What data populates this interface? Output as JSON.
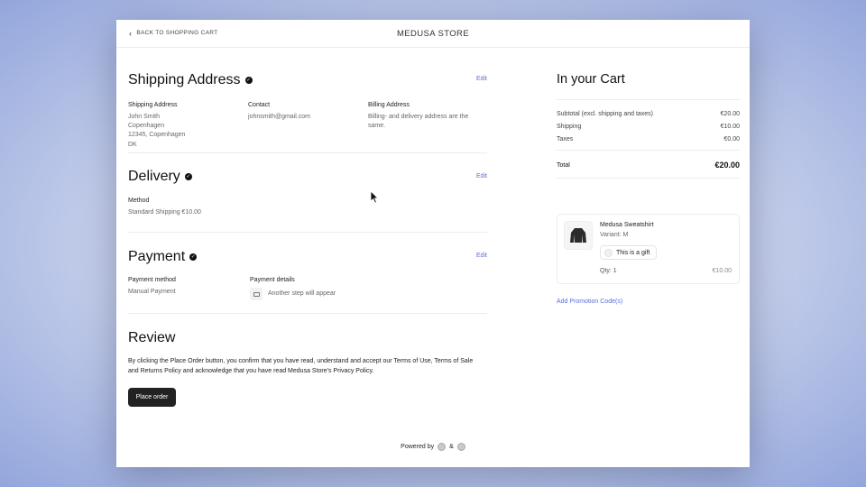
{
  "header": {
    "back_label": "BACK TO SHOPPING CART",
    "store_title": "MEDUSA STORE"
  },
  "shipping": {
    "title": "Shipping Address",
    "edit_label": "Edit",
    "address_label": "Shipping Address",
    "address_lines": [
      "John Smith",
      "Copenhagen",
      "12345, Copenhagen",
      "DK"
    ],
    "contact_label": "Contact",
    "contact_value": "johnsmith@gmail.com",
    "billing_label": "Billing Address",
    "billing_lines": [
      "Billing- and delivery address are the",
      "same."
    ]
  },
  "delivery": {
    "title": "Delivery",
    "edit_label": "Edit",
    "method_label": "Method",
    "method_value": "Standard Shipping €10.00"
  },
  "payment": {
    "title": "Payment",
    "edit_label": "Edit",
    "method_label": "Payment method",
    "method_value": "Manual Payment",
    "details_label": "Payment details",
    "details_value": "Another step will appear"
  },
  "review": {
    "title": "Review",
    "text_lines": [
      "By clicking the Place Order button, you confirm that you have read, understand and accept our Terms of Use, Terms of Sale",
      "and Returns Policy and acknowledge that you have read Medusa Store's Privacy Policy."
    ],
    "place_order_label": "Place order"
  },
  "footer": {
    "powered_by": "Powered by",
    "ampersand": "&"
  },
  "cart": {
    "title": "In your Cart",
    "subtotal_label": "Subtotal (excl. shipping and taxes)",
    "subtotal_value": "€20.00",
    "shipping_label": "Shipping",
    "shipping_value": "€10.00",
    "taxes_label": "Taxes",
    "taxes_value": "€0.00",
    "total_label": "Total",
    "total_value": "€20.00",
    "item": {
      "name": "Medusa Sweatshirt",
      "variant": "Variant: M",
      "gift_label": "This is a gift",
      "qty": "Qty: 1",
      "price": "€10.00"
    },
    "promo_label": "Add Promotion Code(s)"
  },
  "icons": {
    "back": "chevron-left-icon",
    "check": "check-circle-icon",
    "card": "credit-card-icon",
    "product": "sweatshirt-icon",
    "cursor": "mouse-pointer-icon"
  },
  "colors": {
    "accent": "#5b6fd6",
    "button": "#222222"
  }
}
